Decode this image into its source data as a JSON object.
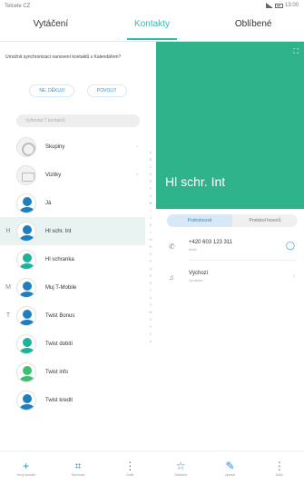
{
  "status": {
    "carrier": "Telcele CZ",
    "time": "13:00"
  },
  "tabs": [
    {
      "label": "Vytáčení",
      "active": false
    },
    {
      "label": "Kontakty",
      "active": true
    },
    {
      "label": "Oblíbené",
      "active": false
    }
  ],
  "sync_prompt": {
    "text": "Umožnit synchronizaci nanovení kontaktů s Kalendářem?",
    "decline": "NE, DĚKUJI",
    "accept": "POVOLIT"
  },
  "search": {
    "placeholder": "Vyhledat 7 kontaktů"
  },
  "contacts": [
    {
      "letter": "",
      "name": "Skupiny",
      "avatar": "group-icon",
      "chevron": true
    },
    {
      "letter": "",
      "name": "Vizitky",
      "avatar": "card-icon",
      "chevron": true
    },
    {
      "letter": "",
      "name": "Já",
      "avatar": "person-icon",
      "chevron": false
    },
    {
      "letter": "H",
      "name": "Hl schr. Int",
      "avatar": "person-icon",
      "chevron": false,
      "selected": true
    },
    {
      "letter": "",
      "name": "Hl schranka",
      "avatar": "person-icon",
      "chevron": false
    },
    {
      "letter": "M",
      "name": "Muj T-Mobile",
      "avatar": "person-icon",
      "chevron": false
    },
    {
      "letter": "T",
      "name": "Twist Bonus",
      "avatar": "person-icon",
      "chevron": false
    },
    {
      "letter": "",
      "name": "Twist dobití",
      "avatar": "person-icon",
      "chevron": false
    },
    {
      "letter": "",
      "name": "Twist info",
      "avatar": "person-icon",
      "chevron": false
    },
    {
      "letter": "",
      "name": "Twist kredit",
      "avatar": "person-icon",
      "chevron": false
    }
  ],
  "index_letters": [
    "A",
    "B",
    "C",
    "D",
    "E",
    "F",
    "G",
    "H",
    "I",
    "J",
    "K",
    "L",
    "M",
    "N",
    "O",
    "P",
    "Q",
    "R",
    "S",
    "T",
    "U",
    "V",
    "W",
    "X",
    "Y",
    "Z",
    "#"
  ],
  "bottom_left": [
    {
      "icon": "plus-icon",
      "glyph": "+",
      "label": "Nový kontakt"
    },
    {
      "icon": "scan-icon",
      "glyph": "⌗",
      "label": "Skenovat"
    },
    {
      "icon": "more-icon",
      "glyph": "⋮",
      "label": "Další"
    }
  ],
  "detail": {
    "name": "Hl schr. Int",
    "subtabs": [
      {
        "label": "Podrobnosti",
        "active": true
      },
      {
        "label": "Protokol hovorů",
        "active": false
      }
    ],
    "phone": {
      "number": "+420 603 123 311",
      "type": "Mobil"
    },
    "ringtone": {
      "label": "Výchozí",
      "sub": "Vyzváněcí"
    }
  },
  "bottom_right": [
    {
      "icon": "star-icon",
      "glyph": "☆",
      "label": "Oblíbené"
    },
    {
      "icon": "edit-icon",
      "glyph": "✎",
      "label": "Upravit"
    },
    {
      "icon": "more-icon",
      "glyph": "⋮",
      "label": "Další"
    }
  ],
  "colors": {
    "accent": "#2bbfaf",
    "header": "#2fb38a",
    "link": "#2b8fd6"
  }
}
